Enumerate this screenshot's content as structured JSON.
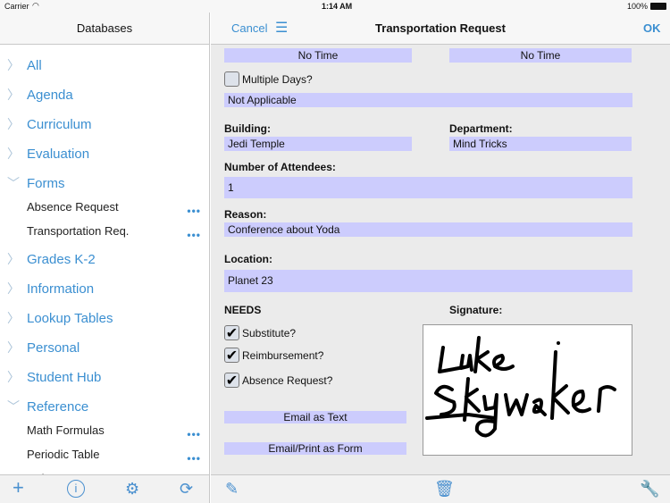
{
  "status": {
    "carrier": "Carrier",
    "time": "1:14 AM",
    "battery": "100%"
  },
  "sidebar": {
    "title": "Databases",
    "categories": [
      {
        "label": "All",
        "expanded": false
      },
      {
        "label": "Agenda",
        "expanded": false
      },
      {
        "label": "Curriculum",
        "expanded": false
      },
      {
        "label": "Evaluation",
        "expanded": false
      },
      {
        "label": "Forms",
        "expanded": true
      },
      {
        "label": "Grades K-2",
        "expanded": false
      },
      {
        "label": "Information",
        "expanded": false
      },
      {
        "label": "Lookup Tables",
        "expanded": false
      },
      {
        "label": "Personal",
        "expanded": false
      },
      {
        "label": "Student Hub",
        "expanded": false
      },
      {
        "label": "Reference",
        "expanded": true
      }
    ],
    "forms_items": [
      "Absence Request",
      "Transportation Req."
    ],
    "reference_items": [
      "Math Formulas",
      "Periodic Table",
      "Unit Convertor"
    ],
    "more": "•••"
  },
  "header": {
    "cancel": "Cancel",
    "title": "Transportation Request",
    "ok": "OK"
  },
  "form": {
    "time_start": "No Time",
    "time_end": "No Time",
    "multiple_days_label": "Multiple Days?",
    "multiple_days": false,
    "multiple_days_value": "Not Applicable",
    "building_label": "Building:",
    "building": "Jedi Temple",
    "department_label": "Department:",
    "department": "Mind Tricks",
    "attendees_label": "Number of Attendees:",
    "attendees": "1",
    "reason_label": "Reason:",
    "reason": "Conference about Yoda",
    "location_label": "Location:",
    "location": "Planet 23",
    "needs_label": "NEEDS",
    "needs": [
      {
        "label": "Substitute?",
        "checked": true
      },
      {
        "label": "Reimbursement?",
        "checked": true
      },
      {
        "label": "Absence Request?",
        "checked": true
      }
    ],
    "signature_label": "Signature:",
    "signature_text": "Luke Skywalker",
    "email_text": "Email as Text",
    "email_form": "Email/Print as Form"
  },
  "colors": {
    "accent": "#3b8fd1",
    "field": "#ccccfd"
  }
}
